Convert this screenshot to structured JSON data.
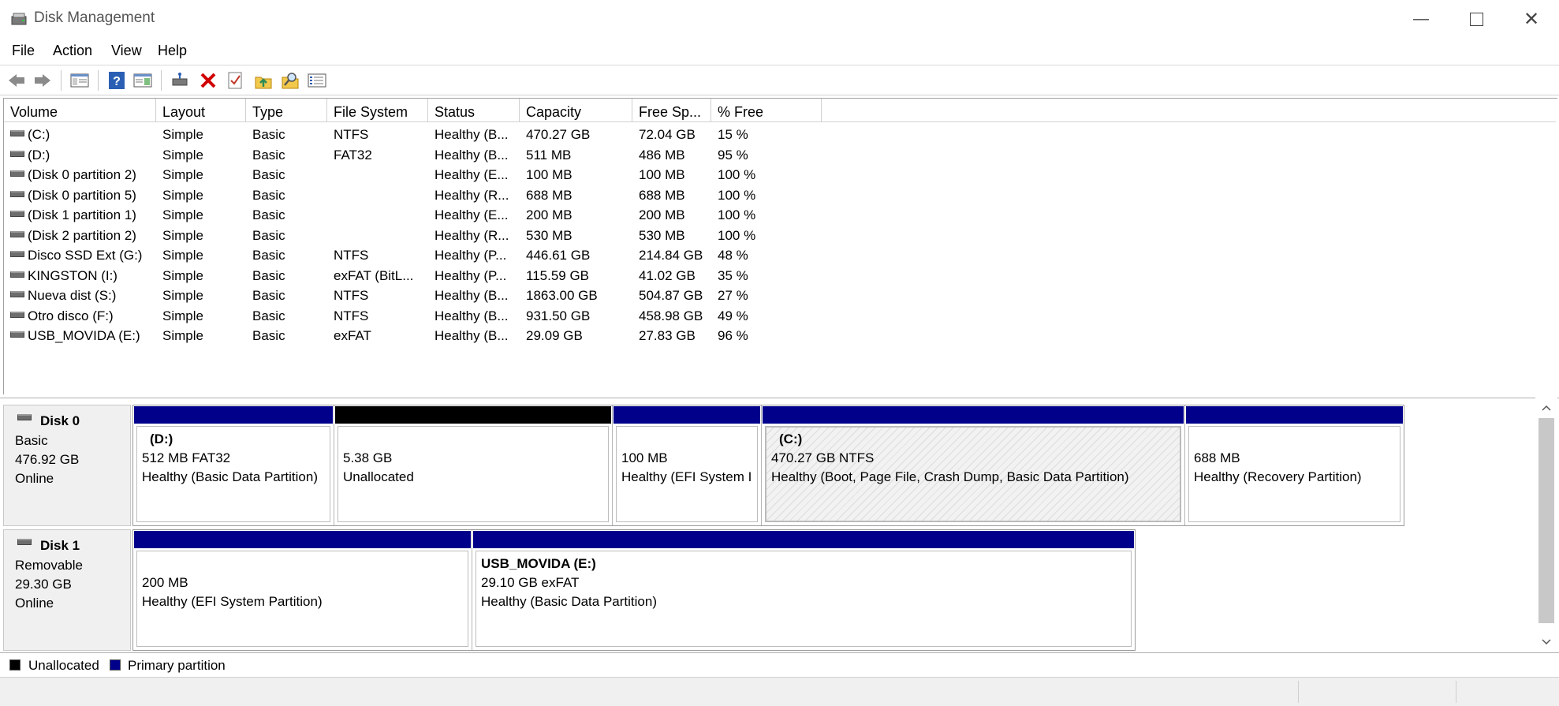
{
  "window": {
    "title": "Disk Management"
  },
  "menu": [
    "File",
    "Action",
    "View",
    "Help"
  ],
  "toolbar": [
    "back-icon",
    "forward-icon",
    "console-tree-icon",
    "help-icon",
    "properties-icon",
    "connect-drive-icon",
    "delete-icon",
    "check-icon",
    "import-icon",
    "search-disk-icon",
    "list-view-icon"
  ],
  "columns": [
    "Volume",
    "Layout",
    "Type",
    "File System",
    "Status",
    "Capacity",
    "Free Sp...",
    "% Free"
  ],
  "volumes": [
    [
      "(C:)",
      "Simple",
      "Basic",
      "NTFS",
      "Healthy (B...",
      "470.27 GB",
      "72.04 GB",
      "15 %"
    ],
    [
      "(D:)",
      "Simple",
      "Basic",
      "FAT32",
      "Healthy (B...",
      "511 MB",
      "486 MB",
      "95 %"
    ],
    [
      "(Disk 0 partition 2)",
      "Simple",
      "Basic",
      "",
      "Healthy (E...",
      "100 MB",
      "100 MB",
      "100 %"
    ],
    [
      "(Disk 0 partition 5)",
      "Simple",
      "Basic",
      "",
      "Healthy (R...",
      "688 MB",
      "688 MB",
      "100 %"
    ],
    [
      "(Disk 1 partition 1)",
      "Simple",
      "Basic",
      "",
      "Healthy (E...",
      "200 MB",
      "200 MB",
      "100 %"
    ],
    [
      "(Disk 2 partition 2)",
      "Simple",
      "Basic",
      "",
      "Healthy (R...",
      "530 MB",
      "530 MB",
      "100 %"
    ],
    [
      "Disco SSD Ext (G:)",
      "Simple",
      "Basic",
      "NTFS",
      "Healthy (P...",
      "446.61 GB",
      "214.84 GB",
      "48 %"
    ],
    [
      "KINGSTON (I:)",
      "Simple",
      "Basic",
      "exFAT (BitL...",
      "Healthy (P...",
      "115.59 GB",
      "41.02 GB",
      "35 %"
    ],
    [
      "Nueva dist (S:)",
      "Simple",
      "Basic",
      "NTFS",
      "Healthy (B...",
      "1863.00 GB",
      "504.87 GB",
      "27 %"
    ],
    [
      "Otro disco (F:)",
      "Simple",
      "Basic",
      "NTFS",
      "Healthy (B...",
      "931.50 GB",
      "458.98 GB",
      "49 %"
    ],
    [
      "USB_MOVIDA (E:)",
      "Simple",
      "Basic",
      "exFAT",
      "Healthy (B...",
      "29.09 GB",
      "27.83 GB",
      "96 %"
    ]
  ],
  "disks": [
    {
      "name": "Disk 0",
      "type": "Basic",
      "size": "476.92 GB",
      "state": "Online",
      "partitions": [
        {
          "label": "(D:)",
          "line1": "512 MB FAT32",
          "line2": "Healthy (Basic Data Partition)",
          "kind": "primary"
        },
        {
          "label": "",
          "line1": "5.38 GB",
          "line2": "Unallocated",
          "kind": "unallocated"
        },
        {
          "label": "",
          "line1": "100 MB",
          "line2": "Healthy (EFI System I",
          "kind": "primary"
        },
        {
          "label": "(C:)",
          "line1": "470.27 GB NTFS",
          "line2": "Healthy (Boot, Page File, Crash Dump, Basic Data Partition)",
          "kind": "primary-selected"
        },
        {
          "label": "",
          "line1": "688 MB",
          "line2": "Healthy (Recovery Partition)",
          "kind": "primary"
        }
      ]
    },
    {
      "name": "Disk 1",
      "type": "Removable",
      "size": "29.30 GB",
      "state": "Online",
      "partitions": [
        {
          "label": "",
          "line1": "200 MB",
          "line2": "Healthy (EFI System Partition)",
          "kind": "primary"
        },
        {
          "label": "USB_MOVIDA  (E:)",
          "line1": "29.10 GB exFAT",
          "line2": "Healthy (Basic Data Partition)",
          "kind": "primary"
        }
      ]
    }
  ],
  "legend": [
    {
      "label": "Unallocated",
      "color": "#000000"
    },
    {
      "label": "Primary partition",
      "color": "#00008b"
    }
  ]
}
